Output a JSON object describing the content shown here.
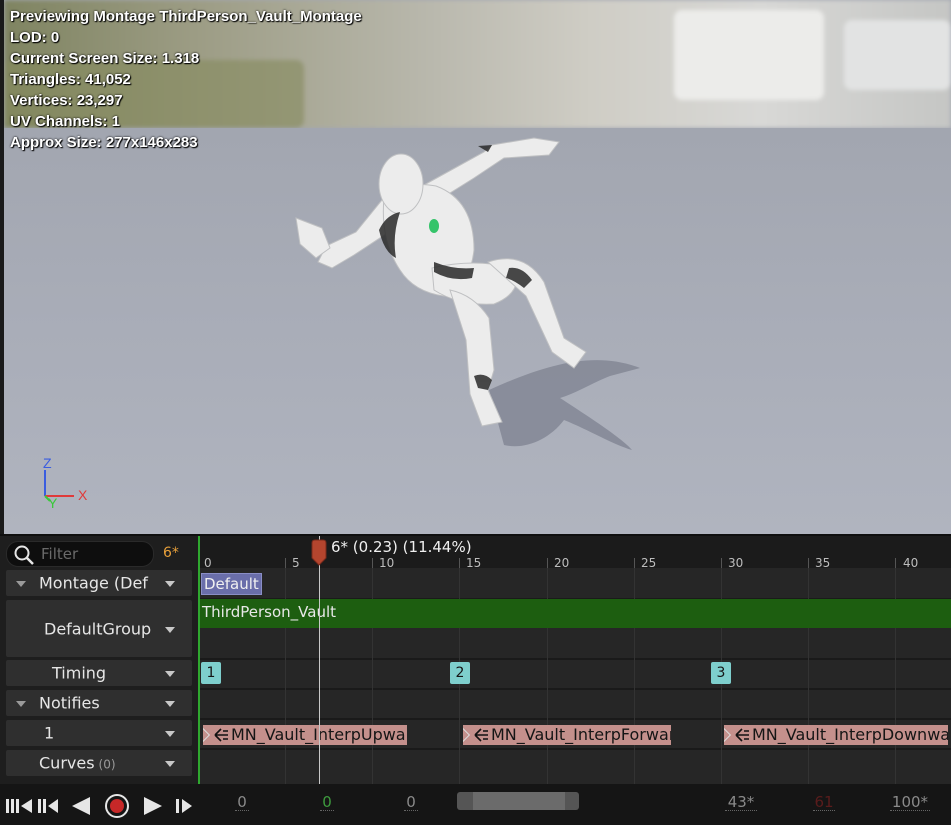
{
  "viewport": {
    "stats": [
      "Previewing Montage ThirdPerson_Vault_Montage",
      "LOD: 0",
      "Current Screen Size: 1.318",
      "Triangles: 41,052",
      "Vertices: 23,297",
      "UV Channels: 1",
      "Approx Size: 277x146x283"
    ],
    "axes": {
      "z": "Z",
      "x": "X",
      "y": "Y"
    }
  },
  "timeline": {
    "filter_placeholder": "Filter",
    "frame_indicator": "6*",
    "tracks": {
      "montage": "Montage (Def",
      "group": "DefaultGroup",
      "timing": "Timing",
      "notifies": "Notifies",
      "notify_track": "1",
      "curves": "Curves",
      "curves_count": "(0)"
    },
    "ruler_ticks": [
      "0",
      "5",
      "10",
      "15",
      "20",
      "25",
      "30",
      "35",
      "40"
    ],
    "playhead_label": "6* (0.23) (11.44%)",
    "section_name": "Default",
    "montage_segment": "ThirdPerson_Vault",
    "section_markers": [
      "1",
      "2",
      "3"
    ],
    "notifies": [
      "MN_Vault_InterpUpwar",
      "MN_Vault_InterpForwar",
      "MN_Vault_InterpDownwa"
    ]
  },
  "transport": {
    "start_value": "0",
    "current_value": "0",
    "secondary_value": "0",
    "range_end": "43*",
    "max_frame": "61",
    "zoom": "100*"
  },
  "colors": {
    "montage_bar": "#1d5e10",
    "section_tag": "#6a6eaa",
    "section_marker": "#7ecfcd",
    "notify": "#c4908c",
    "frame_indicator": "#e8a03a",
    "record": "#c62828"
  }
}
